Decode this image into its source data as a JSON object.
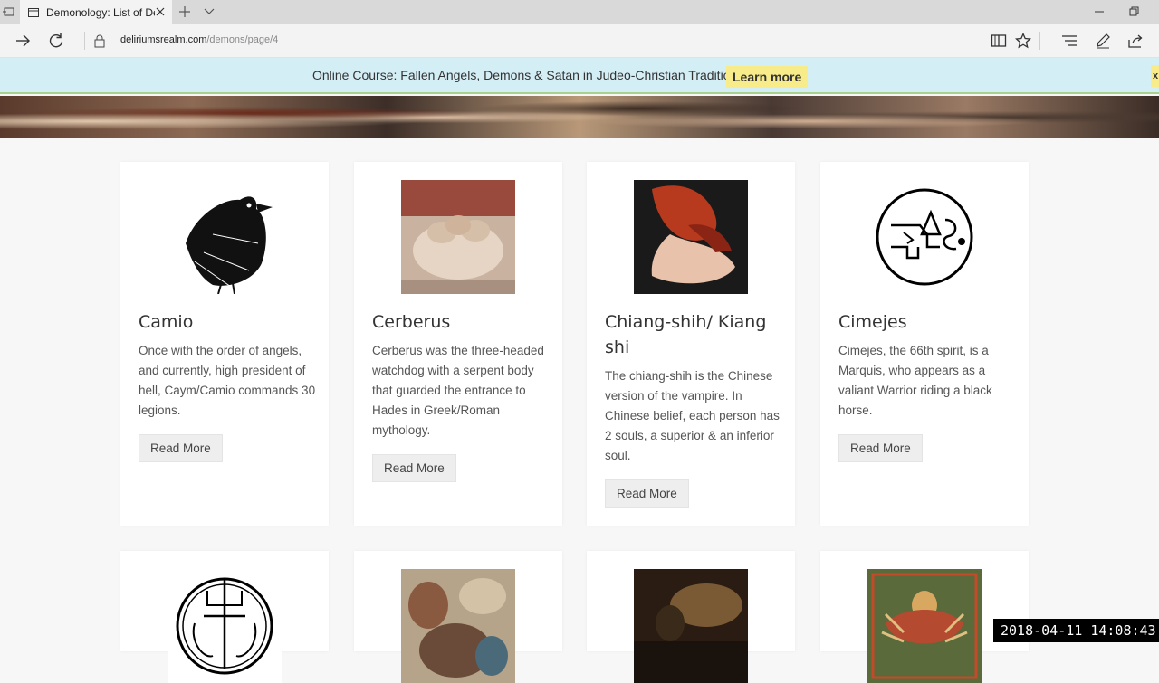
{
  "browser": {
    "tab_title": "Demonology: List of De",
    "url_host": "deliriumsrealm.com",
    "url_path": "/demons/page/4"
  },
  "banner": {
    "text": "Online Course: Fallen Angels, Demons & Satan in Judeo-Christian Traditions",
    "button": "Learn more",
    "close": "x"
  },
  "cards": [
    {
      "title": "Camio",
      "text": "Once with the order of angels, and currently, high president of hell, Caym/Camio commands 30 legions.",
      "button": "Read More",
      "image": "raven-engraving"
    },
    {
      "title": "Cerberus",
      "text": "Cerberus was the three-headed watchdog with a serpent body that guarded the entrance to Hades in Greek/Roman mythology.",
      "button": "Read More",
      "image": "cerberus-painting"
    },
    {
      "title": "Chiang-shih/ Kiang shi",
      "text": "The chiang-shih is the Chinese version of the vampire. In Chinese belief, each person has 2 souls, a superior & an inferior soul.",
      "button": "Read More",
      "image": "vampire-painting"
    },
    {
      "title": "Cimejes",
      "text": "Cimejes, the 66th spirit, is a Marquis, who appears as a valiant Warrior riding a black horse.",
      "button": "Read More",
      "image": "cimejes-seal"
    }
  ],
  "row2_images": [
    "demon-seal",
    "renaissance-painting",
    "landscape-painting",
    "indian-deity-painting"
  ],
  "timestamp": "2018-04-11  14:08:43"
}
